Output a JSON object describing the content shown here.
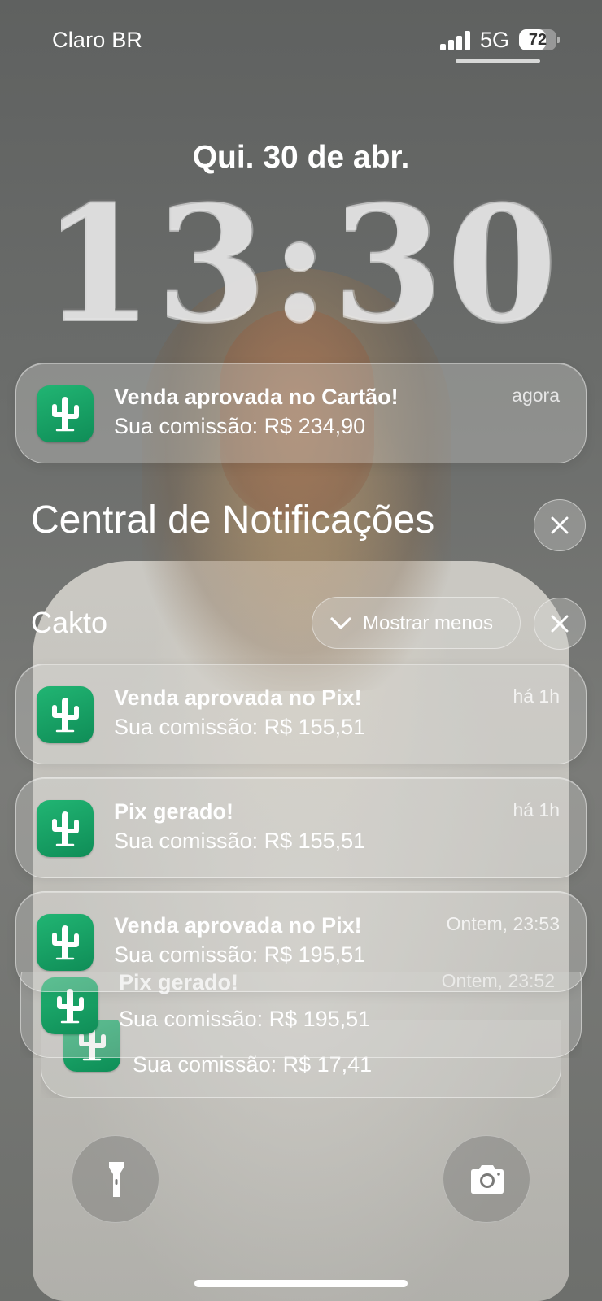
{
  "status_bar": {
    "carrier": "Claro BR",
    "network": "5G",
    "battery_percent": "72",
    "battery_level": 0.72,
    "signal_bars": 4
  },
  "lock_screen": {
    "date": "Qui. 30 de abr.",
    "time": "13:30"
  },
  "app_icon": "cactus-icon",
  "top_notification": {
    "title": "Venda aprovada no Cartão!",
    "body": "Sua comissão: R$ 234,90",
    "time": "agora"
  },
  "notification_center": {
    "title": "Central de Notificações",
    "clear_icon": "close-icon"
  },
  "group": {
    "app_name": "Cakto",
    "show_less_label": "Mostrar menos",
    "show_less_icon": "chevron-down-icon",
    "clear_icon": "close-icon",
    "notifications": [
      {
        "title": "Venda aprovada no Pix!",
        "body": "Sua comissão: R$ 155,51",
        "time": "há 1h"
      },
      {
        "title": "Pix gerado!",
        "body": "Sua comissão: R$ 155,51",
        "time": "há 1h"
      },
      {
        "title": "Venda aprovada no Pix!",
        "body": "Sua comissão: R$ 195,51",
        "time": "Ontem, 23:53"
      },
      {
        "title": "Pix gerado!",
        "body": "Sua comissão: R$ 195,51",
        "time": "Ontem, 23:52"
      },
      {
        "title": "",
        "body": "Sua comissão: R$ 17,41",
        "time": ""
      }
    ]
  },
  "bottom_actions": {
    "left_icon": "flashlight-icon",
    "right_icon": "camera-icon"
  },
  "colors": {
    "app_icon_green": "#1aa366",
    "glass": "#d7d7d4"
  }
}
